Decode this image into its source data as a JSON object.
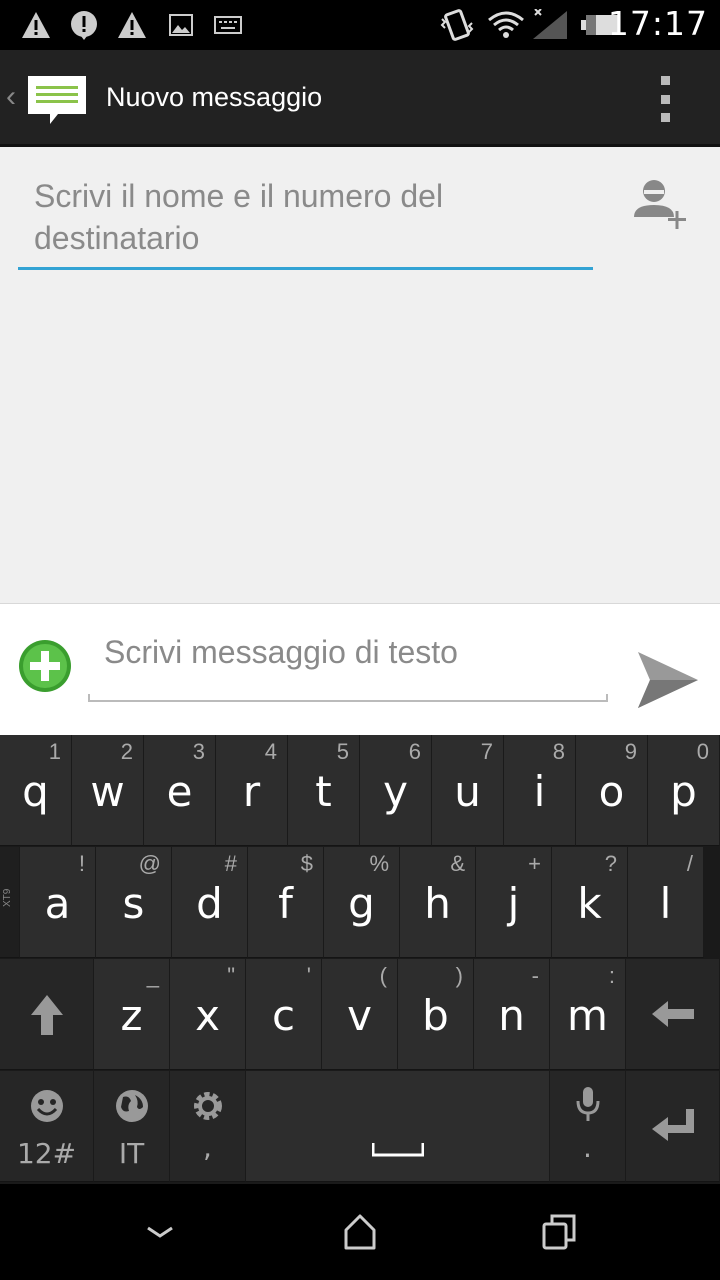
{
  "status_bar": {
    "time": "17:17",
    "icons": [
      "warning-icon",
      "alert-icon",
      "warning-icon",
      "image-icon",
      "keyboard-icon",
      "vibrate-icon",
      "wifi-icon",
      "signal-icon",
      "battery-icon"
    ]
  },
  "action_bar": {
    "title": "Nuovo messaggio",
    "app_icon": "messages-icon",
    "menu_icon": "overflow-menu-icon"
  },
  "recipient": {
    "placeholder": "Scrivi il nome e il numero del destinatario",
    "add_contact_icon": "add-contact-icon"
  },
  "compose": {
    "placeholder": "Scrivi messaggio di testo",
    "attach_icon": "attach-plus-icon",
    "send_icon": "send-icon"
  },
  "keyboard": {
    "row1": [
      {
        "main": "q",
        "sub": "1"
      },
      {
        "main": "w",
        "sub": "2"
      },
      {
        "main": "e",
        "sub": "3"
      },
      {
        "main": "r",
        "sub": "4"
      },
      {
        "main": "t",
        "sub": "5"
      },
      {
        "main": "y",
        "sub": "6"
      },
      {
        "main": "u",
        "sub": "7"
      },
      {
        "main": "i",
        "sub": "8"
      },
      {
        "main": "o",
        "sub": "9"
      },
      {
        "main": "p",
        "sub": "0"
      }
    ],
    "row2": [
      {
        "main": "a",
        "sub": "!"
      },
      {
        "main": "s",
        "sub": "@"
      },
      {
        "main": "d",
        "sub": "#"
      },
      {
        "main": "f",
        "sub": "$"
      },
      {
        "main": "g",
        "sub": "%"
      },
      {
        "main": "h",
        "sub": "&"
      },
      {
        "main": "j",
        "sub": "+"
      },
      {
        "main": "k",
        "sub": "?"
      },
      {
        "main": "l",
        "sub": "/"
      }
    ],
    "xt9_label": "XT9",
    "row3": [
      {
        "main": "z",
        "sub": "_"
      },
      {
        "main": "x",
        "sub": "\""
      },
      {
        "main": "c",
        "sub": "'"
      },
      {
        "main": "v",
        "sub": "("
      },
      {
        "main": "b",
        "sub": ")"
      },
      {
        "main": "n",
        "sub": "-"
      },
      {
        "main": "m",
        "sub": ":"
      }
    ],
    "symbols_label": "12#",
    "language_label": "IT",
    "comma_label": ",",
    "period_label": "."
  },
  "nav_bar": {
    "back_icon": "back-chevron-icon",
    "home_icon": "home-icon",
    "recents_icon": "recent-apps-icon"
  }
}
